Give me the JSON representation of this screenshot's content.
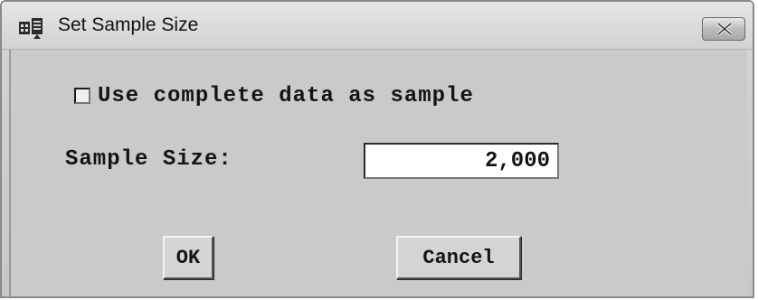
{
  "window": {
    "title": "Set Sample Size",
    "app_icon": "sas-dialog-icon",
    "close_icon": "close-icon"
  },
  "options": {
    "use_complete_label": "Use complete data as sample",
    "use_complete_checked": false
  },
  "sample_size": {
    "label": "Sample Size:",
    "value": "2,000"
  },
  "buttons": {
    "ok_label": "OK",
    "cancel_label": "Cancel"
  },
  "colors": {
    "dialog_bg": "#cacaca",
    "title_bg": "#d2d2d2",
    "input_bg": "#ffffff",
    "text": "#141414"
  }
}
